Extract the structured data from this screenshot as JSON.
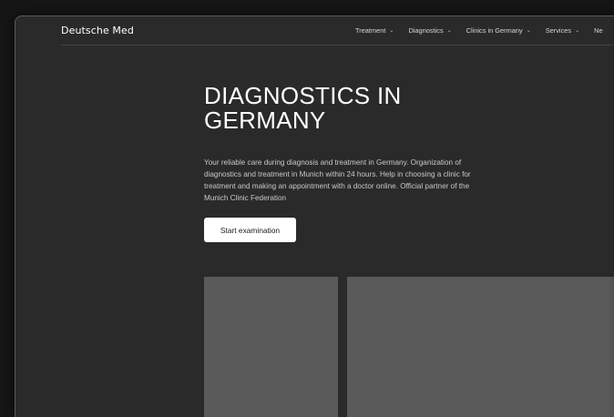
{
  "header": {
    "logo": "Deutsche Med",
    "nav": [
      {
        "label": "Treatment",
        "has_dropdown": true
      },
      {
        "label": "Diagnostics",
        "has_dropdown": true
      },
      {
        "label": "Clinics in Germany",
        "has_dropdown": true
      },
      {
        "label": "Services",
        "has_dropdown": true
      },
      {
        "label": "Ne",
        "has_dropdown": false
      }
    ]
  },
  "hero": {
    "title": "DIAGNOSTICS IN GERMANY",
    "description": "Your reliable care during diagnosis and treatment in Germany. Organization of diagnostics and treatment in Munich within 24 hours. Help in choosing a clinic for treatment and making an appointment with a doctor online. Official partner of the Munich Clinic Federation",
    "cta_label": "Start examination"
  },
  "colors": {
    "page_background": "#2a2a2a",
    "card_placeholder": "#5a5a5a",
    "cta_background": "#ffffff"
  }
}
